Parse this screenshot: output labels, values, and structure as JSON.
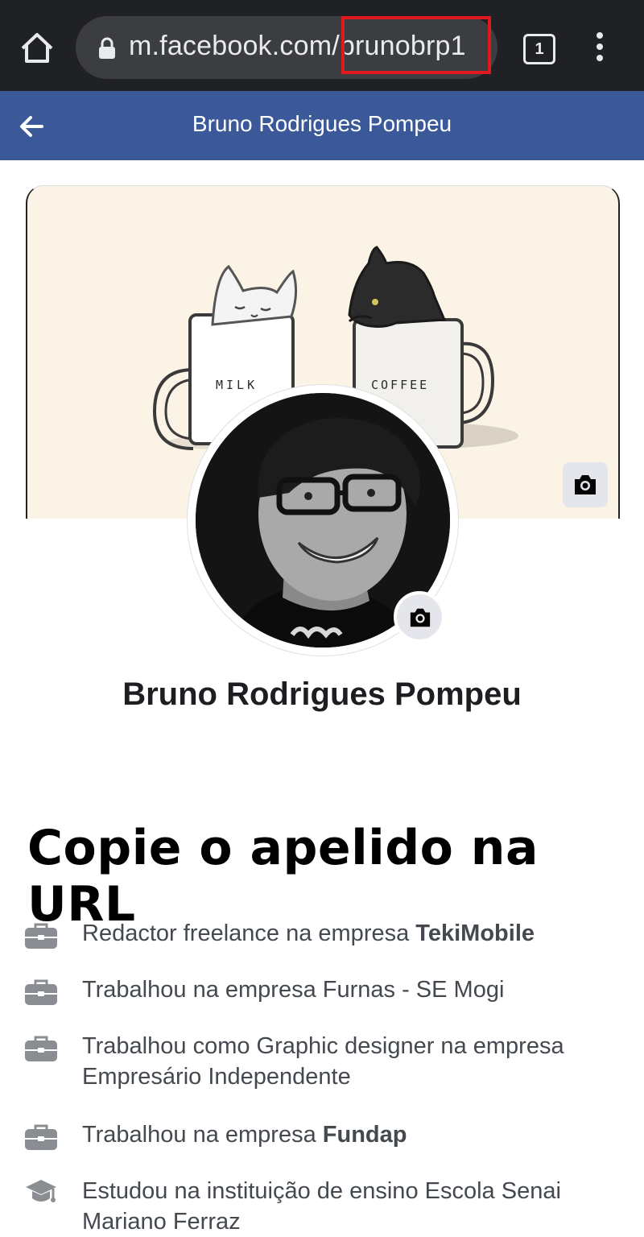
{
  "browser": {
    "url_host": "m.facebook.com",
    "url_path": "/brunobrp1",
    "tab_count": "1"
  },
  "header": {
    "title": "Bruno Rodrigues Pompeu"
  },
  "cover": {
    "mug_left_label": "MILK",
    "mug_right_label": "COFFEE"
  },
  "profile": {
    "name": "Bruno Rodrigues Pompeu"
  },
  "instruction": "Copie o apelido na URL",
  "info": [
    {
      "icon": "briefcase-icon",
      "text": "Redactor freelance na empresa ",
      "bold": "TekiMobile"
    },
    {
      "icon": "briefcase-icon",
      "text": "Trabalhou na empresa Furnas - SE Mogi",
      "bold": ""
    },
    {
      "icon": "briefcase-icon",
      "text": "Trabalhou como Graphic designer na empresa Empresário Independente",
      "bold": ""
    },
    {
      "icon": "briefcase-icon",
      "text": "Trabalhou na empresa ",
      "bold": "Fundap"
    },
    {
      "icon": "graduation-cap-icon",
      "text": "Estudou na instituição de ensino Escola Senai Mariano Ferraz",
      "bold": ""
    }
  ],
  "colors": {
    "browser_bar": "#202124",
    "fb_blue": "#3b5998",
    "highlight": "#e0191f",
    "cover_bg": "#fbf4e6"
  }
}
